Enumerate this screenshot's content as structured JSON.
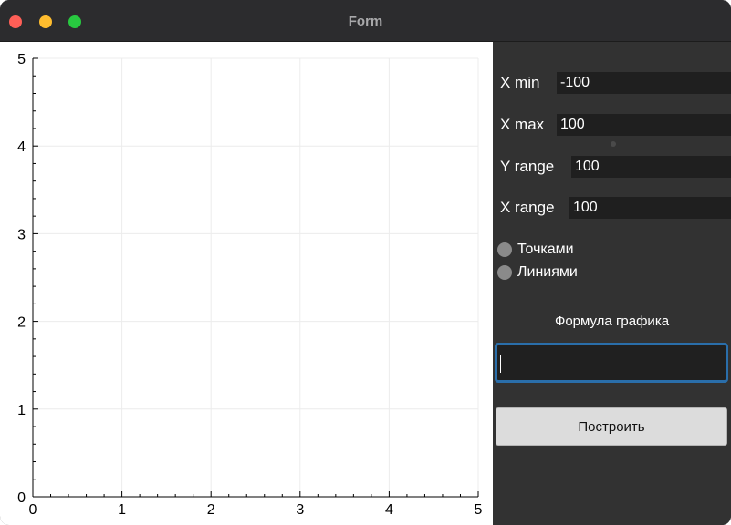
{
  "window": {
    "title": "Form"
  },
  "panel": {
    "x_min": {
      "label": "X min",
      "value": "-100"
    },
    "x_max": {
      "label": "X max",
      "value": "100"
    },
    "y_range": {
      "label": "Y range",
      "value": "100"
    },
    "x_range": {
      "label": "X range",
      "value": "100"
    },
    "radio_points": {
      "label": "Точками",
      "checked": false
    },
    "radio_lines": {
      "label": "Линиями",
      "checked": false
    },
    "formula": {
      "label": "Формула графика",
      "value": ""
    },
    "build_button": "Построить"
  },
  "chart_data": {
    "type": "line",
    "title": "",
    "xlabel": "",
    "ylabel": "",
    "xlim": [
      0,
      5
    ],
    "ylim": [
      0,
      5
    ],
    "xticks": [
      "0",
      "1",
      "2",
      "3",
      "4",
      "5"
    ],
    "yticks": [
      "0",
      "1",
      "2",
      "3",
      "4",
      "5"
    ],
    "grid": true,
    "series": []
  }
}
